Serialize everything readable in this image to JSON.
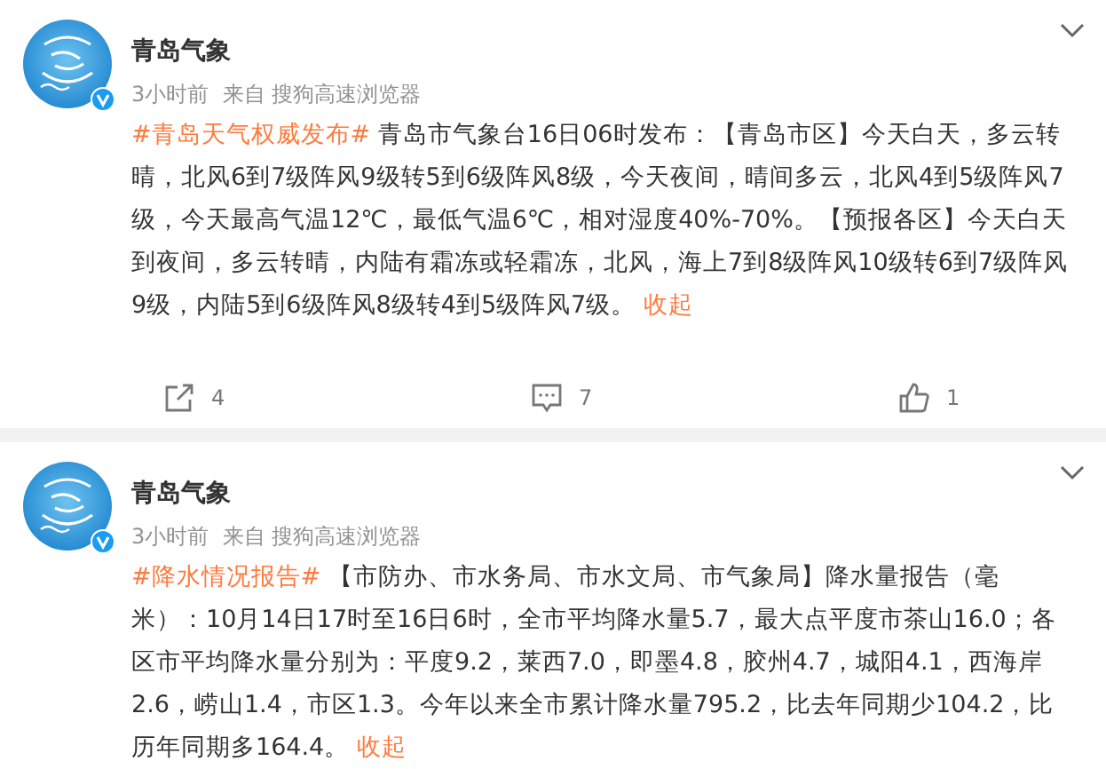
{
  "posts": [
    {
      "author": "青岛气象",
      "verified": true,
      "meta": "3小时前  来自 搜狗高速浏览器",
      "hashtag": "#青岛天气权威发布#",
      "text": " 青岛市气象台16日06时发布：【青岛市区】今天白天，多云转晴，北风6到7级阵风9级转5到6级阵风8级，今天夜间，晴间多云，北风4到5级阵风7级，今天最高气温12℃，最低气温6℃，相对湿度40%-70%。【预报各区】今天白天到夜间，多云转晴，内陆有霜冻或轻霜冻，北风，海上7到8级阵风10级转6到7级阵风9级，内陆5到6级阵风8级转4到5级阵风7级。",
      "collapse": "收起",
      "actions": {
        "shares": "4",
        "comments": "7",
        "likes": "1"
      }
    },
    {
      "author": "青岛气象",
      "verified": true,
      "meta": "3小时前  来自 搜狗高速浏览器",
      "hashtag": "#降水情况报告#",
      "text": " 【市防办、市水务局、市水文局、市气象局】降水量报告（毫米）：10月14日17时至16日6时，全市平均降水量5.7，最大点平度市茶山16.0；各区市平均降水量分别为：平度9.2，莱西7.0，即墨4.8，胶州4.7，城阳4.1，西海岸2.6，崂山1.4，市区1.3。今年以来全市累计降水量795.2，比去年同期少104.2，比历年同期多164.4。",
      "collapse": "收起"
    }
  ]
}
